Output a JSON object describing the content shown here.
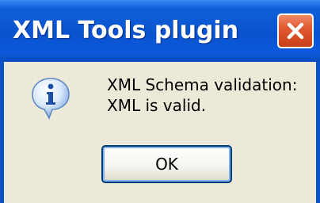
{
  "dialog": {
    "title": "XML Tools plugin",
    "close_icon": "close-icon",
    "icon": "information-icon",
    "message_line1": "XML Schema validation:",
    "message_line2": "XML is valid.",
    "ok_label": "OK"
  },
  "colors": {
    "titlebar": "#0a53d0",
    "close_button": "#e25a30",
    "client_bg": "#ece9d8",
    "button_border": "#003c74"
  }
}
